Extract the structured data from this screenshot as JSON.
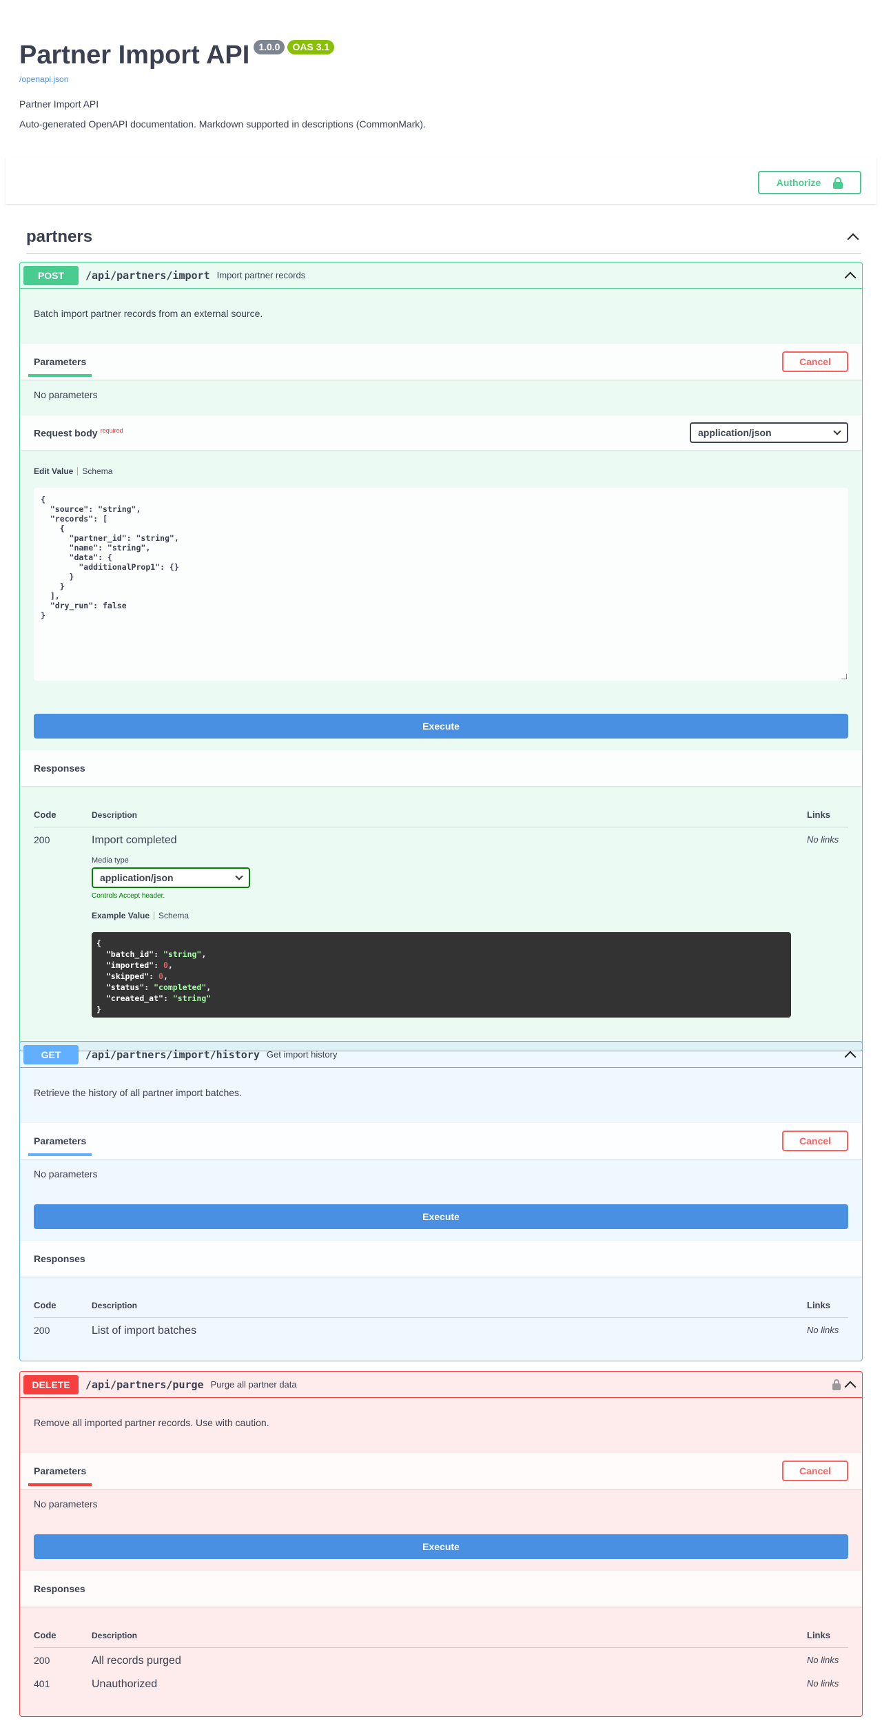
{
  "info": {
    "title": "Partner Import API",
    "version": "1.0.0",
    "oas": "OAS 3.1",
    "spec_link": "/openapi.json",
    "line1": "Partner Import API",
    "line2": "Auto-generated OpenAPI documentation. Markdown supported in descriptions (CommonMark)."
  },
  "authorize_label": "Authorize",
  "tag": {
    "name": "partners"
  },
  "common": {
    "parameters": "Parameters",
    "cancel": "Cancel",
    "no_parameters": "No parameters",
    "execute": "Execute",
    "responses": "Responses",
    "col_code": "Code",
    "col_description": "Description",
    "col_links": "Links",
    "no_links": "No links"
  },
  "post_op": {
    "method": "POST",
    "path": "/api/partners/import",
    "summary": "Import partner records",
    "description": "Batch import partner records from an external source.",
    "request_body": "Request body",
    "required": "required",
    "content_type": "application/json",
    "edit_value": "Edit Value",
    "schema": "Schema",
    "body_example": "{\n  \"source\": \"string\",\n  \"records\": [\n    {\n      \"partner_id\": \"string\",\n      \"name\": \"string\",\n      \"data\": {\n        \"additionalProp1\": {}\n      }\n    }\n  ],\n  \"dry_run\": false\n}",
    "response_code": "200",
    "response_desc": "Import completed",
    "media_type_label": "Media type",
    "media_type": "application/json",
    "accept_note": "Controls Accept header.",
    "example_value": "Example Value",
    "example_schema": "Schema",
    "example": {
      "open": "{",
      "batch_id": "\"string\"",
      "imported": "0",
      "skipped": "0",
      "status": "\"completed\"",
      "created_at": "\"string\"",
      "close": "}"
    }
  },
  "get_op": {
    "method": "GET",
    "path": "/api/partners/import/history",
    "summary": "Get import history",
    "description": "Retrieve the history of all partner import batches.",
    "response_code": "200",
    "response_desc": "List of import batches"
  },
  "delete_op": {
    "method": "DELETE",
    "path": "/api/partners/purge",
    "summary": "Purge all partner data",
    "description": "Remove all imported partner records. Use with caution.",
    "responses": [
      {
        "code": "200",
        "desc": "All records purged"
      },
      {
        "code": "401",
        "desc": "Unauthorized"
      }
    ]
  },
  "colors": {
    "post": "#49cc90",
    "get": "#61affe",
    "delete": "#f93e3e",
    "execute": "#4990e2"
  }
}
